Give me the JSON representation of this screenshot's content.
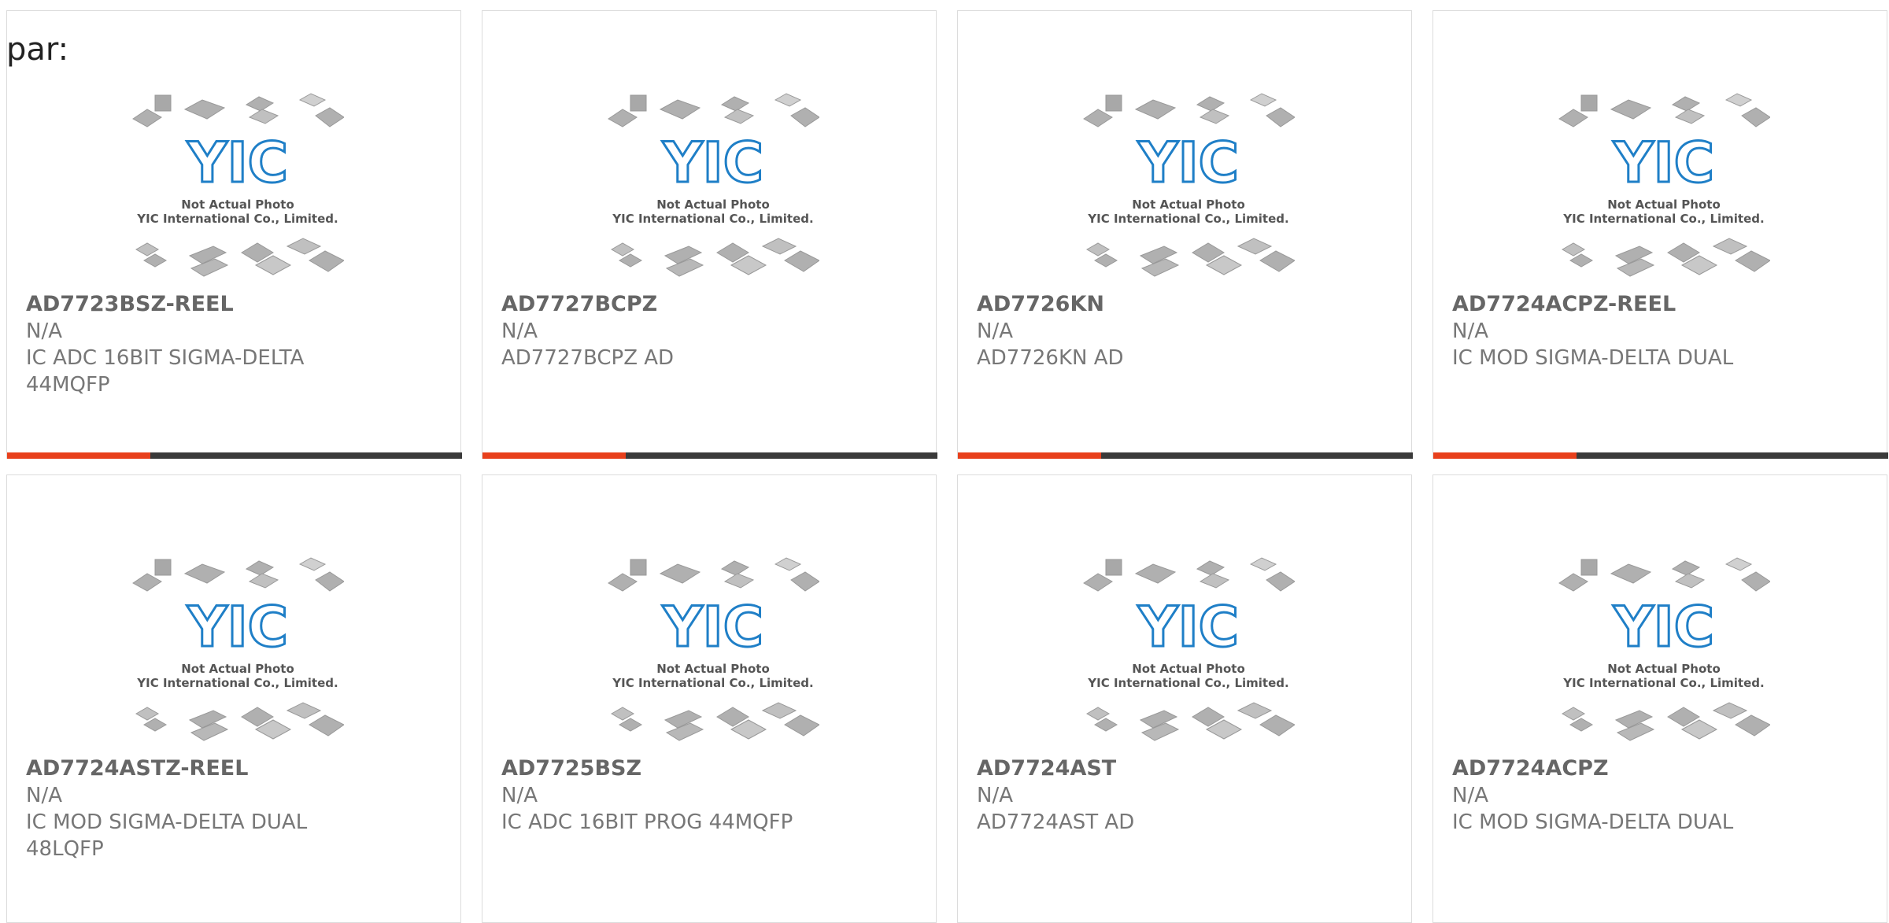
{
  "page": {
    "heading": "par:"
  },
  "placeholder_image": {
    "logo": "YIC",
    "line1": "Not Actual Photo",
    "line2": "YIC International Co., Limited."
  },
  "colors": {
    "accent": "#e8401c",
    "bar": "#3a3a3a",
    "logo": "#1f7fc7"
  },
  "products": [
    {
      "part": "AD7723BSZ-REEL",
      "stock": "N/A",
      "desc1": "IC ADC 16BIT SIGMA-DELTA",
      "desc2": "44MQFP"
    },
    {
      "part": "AD7727BCPZ",
      "stock": "N/A",
      "desc1": "AD7727BCPZ AD",
      "desc2": ""
    },
    {
      "part": "AD7726KN",
      "stock": "N/A",
      "desc1": "AD7726KN AD",
      "desc2": ""
    },
    {
      "part": "AD7724ACPZ-REEL",
      "stock": "N/A",
      "desc1": "IC MOD SIGMA-DELTA DUAL",
      "desc2": ""
    },
    {
      "part": "AD7724ASTZ-REEL",
      "stock": "N/A",
      "desc1": "IC MOD SIGMA-DELTA DUAL",
      "desc2": "48LQFP"
    },
    {
      "part": "AD7725BSZ",
      "stock": "N/A",
      "desc1": "IC ADC 16BIT PROG 44MQFP",
      "desc2": ""
    },
    {
      "part": "AD7724AST",
      "stock": "N/A",
      "desc1": "AD7724AST AD",
      "desc2": ""
    },
    {
      "part": "AD7724ACPZ",
      "stock": "N/A",
      "desc1": "IC MOD SIGMA-DELTA DUAL",
      "desc2": ""
    }
  ]
}
